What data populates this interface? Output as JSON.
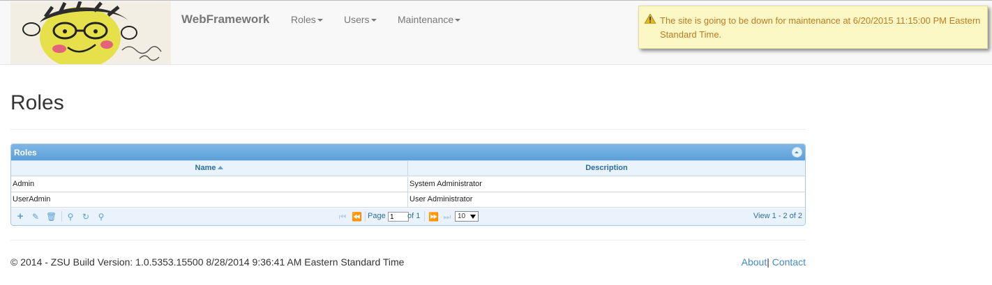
{
  "navbar": {
    "brand": "WebFramework",
    "menu": [
      {
        "label": "Roles"
      },
      {
        "label": "Users"
      },
      {
        "label": "Maintenance"
      }
    ]
  },
  "notice": {
    "text": "The site is going to be down for maintenance at 6/20/2015 11:15:00 PM Eastern Standard Time.",
    "icon": "warning-icon"
  },
  "page": {
    "title": "Roles"
  },
  "grid": {
    "caption": "Roles",
    "columns": [
      "Name",
      "Description"
    ],
    "rows": [
      {
        "name": "Admin",
        "description": "System Administrator"
      },
      {
        "name": "UserAdmin",
        "description": "User Administrator"
      }
    ],
    "pager": {
      "page_label": "Page",
      "page_value": "1",
      "of_label": "of 1",
      "rows_per_page": "10",
      "view_info": "View 1 - 2 of 2"
    }
  },
  "footer": {
    "text": "© 2014 - ZSU Build Version: 1.0.5353.15500 8/28/2014 9:36:41 AM Eastern Standard Time",
    "about": "About",
    "separator": "|",
    "contact": "Contact"
  },
  "colors": {
    "accent": "#428bca",
    "notice_bg": "#fbf8c6",
    "notice_text": "#c07a1e",
    "grid_header": "#5b9fd9"
  }
}
